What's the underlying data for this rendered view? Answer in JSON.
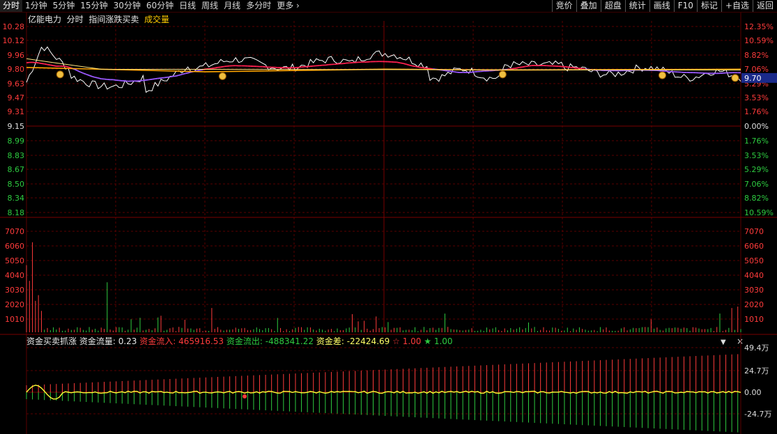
{
  "toolbar": {
    "tabs": [
      "分时",
      "1分钟",
      "5分钟",
      "15分钟",
      "30分钟",
      "60分钟",
      "日线",
      "周线",
      "月线",
      "多分时",
      "更多"
    ],
    "right_buttons": [
      "竞价",
      "叠加",
      "超盘",
      "统计",
      "画线",
      "F10",
      "标记",
      "+自选",
      "返回"
    ]
  },
  "price_header": {
    "name": "亿能电力",
    "mode": "分时",
    "indicator": "指间涨跌买卖",
    "volume_label": "成交量"
  },
  "price_axis": {
    "left": [
      "10.28",
      "10.12",
      "9.96",
      "9.80",
      "9.63",
      "9.47",
      "9.31",
      "9.15",
      "8.99",
      "8.83",
      "8.67",
      "8.50",
      "8.34",
      "8.18"
    ],
    "right": [
      "12.35%",
      "10.59%",
      "8.82%",
      "7.06%",
      "5.29%",
      "3.53%",
      "1.76%",
      "0.00%",
      "1.76%",
      "3.53%",
      "5.29%",
      "7.06%",
      "8.82%",
      "10.59%"
    ],
    "current_price": "9.70"
  },
  "volume_axis": [
    "7070",
    "6060",
    "5050",
    "4040",
    "3030",
    "2020",
    "1010"
  ],
  "fund_panel": {
    "name": "资金买卖抓涨",
    "flow_label": "资金流量:",
    "flow_value": "0.23",
    "in_label": "资金流入:",
    "in_value": "465916.53",
    "out_label": "资金流出:",
    "out_value": "-488341.22",
    "diff_label": "资金差:",
    "diff_value": "-22424.69",
    "star_red": "1.00",
    "star_green": "1.00",
    "axis": [
      "49.4万",
      "24.7万",
      "0.00",
      "-24.7万"
    ],
    "collapse_icon": "▼",
    "close_icon": "×"
  },
  "colors": {
    "up": "#ff3b3b",
    "down": "#2ecc40",
    "grid": "#5a0000",
    "price_line": "#ffffff",
    "avg_red": "#ff2050",
    "avg_purple": "#9b59ff",
    "orange": "#ffa500",
    "yellow": "#ffff33"
  }
}
